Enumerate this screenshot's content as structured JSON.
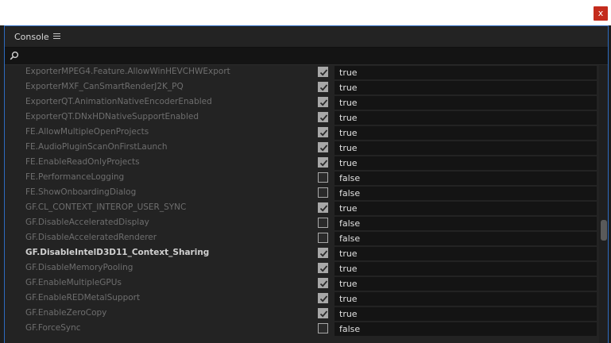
{
  "window": {
    "close_label": "x"
  },
  "panel": {
    "title": "Console"
  },
  "search": {
    "value": "",
    "placeholder": ""
  },
  "scroll": {
    "position_fraction": 0.6
  },
  "rows": [
    {
      "name": "ExporterMPEG4.Feature.AllowWinHEVCHWExport",
      "checked": true,
      "value": "true",
      "bold": false
    },
    {
      "name": "ExporterMXF_CanSmartRenderJ2K_PQ",
      "checked": true,
      "value": "true",
      "bold": false
    },
    {
      "name": "ExporterQT.AnimationNativeEncoderEnabled",
      "checked": true,
      "value": "true",
      "bold": false
    },
    {
      "name": "ExporterQT.DNxHDNativeSupportEnabled",
      "checked": true,
      "value": "true",
      "bold": false
    },
    {
      "name": "FE.AllowMultipleOpenProjects",
      "checked": true,
      "value": "true",
      "bold": false
    },
    {
      "name": "FE.AudioPluginScanOnFirstLaunch",
      "checked": true,
      "value": "true",
      "bold": false
    },
    {
      "name": "FE.EnableReadOnlyProjects",
      "checked": true,
      "value": "true",
      "bold": false
    },
    {
      "name": "FE.PerformanceLogging",
      "checked": false,
      "value": "false",
      "bold": false
    },
    {
      "name": "FE.ShowOnboardingDialog",
      "checked": false,
      "value": "false",
      "bold": false
    },
    {
      "name": "GF.CL_CONTEXT_INTEROP_USER_SYNC",
      "checked": true,
      "value": "true",
      "bold": false
    },
    {
      "name": "GF.DisableAcceleratedDisplay",
      "checked": false,
      "value": "false",
      "bold": false
    },
    {
      "name": "GF.DisableAcceleratedRenderer",
      "checked": false,
      "value": "false",
      "bold": false
    },
    {
      "name": "GF.DisableIntelD3D11_Context_Sharing",
      "checked": true,
      "value": "true",
      "bold": true
    },
    {
      "name": "GF.DisableMemoryPooling",
      "checked": true,
      "value": "true",
      "bold": false
    },
    {
      "name": "GF.EnableMultipleGPUs",
      "checked": true,
      "value": "true",
      "bold": false
    },
    {
      "name": "GF.EnableREDMetalSupport",
      "checked": true,
      "value": "true",
      "bold": false
    },
    {
      "name": "GF.EnableZeroCopy",
      "checked": true,
      "value": "true",
      "bold": false
    },
    {
      "name": "GF.ForceSync",
      "checked": false,
      "value": "false",
      "bold": false
    }
  ]
}
